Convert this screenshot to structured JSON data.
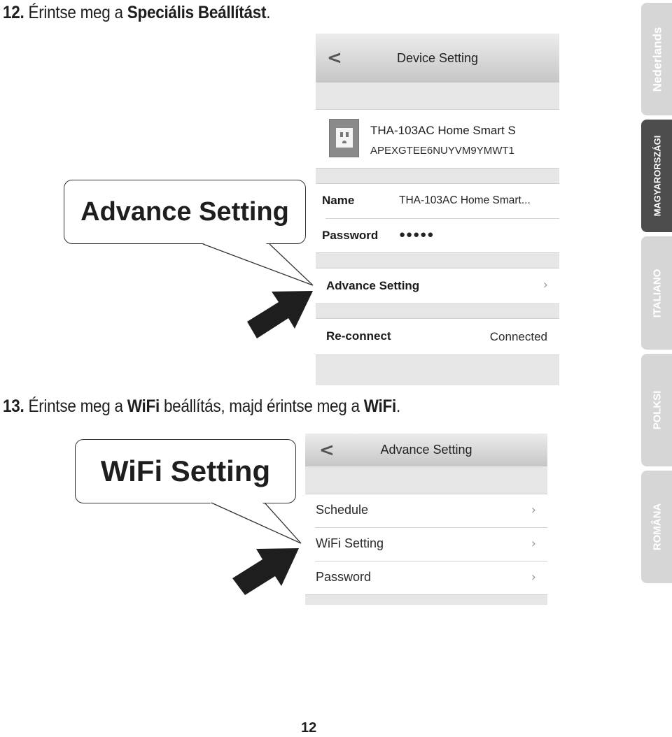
{
  "steps": [
    {
      "number": "12.",
      "text_parts": [
        "Érintse meg a ",
        "Speciális Beállítást",
        "."
      ]
    },
    {
      "number": "13.",
      "text_parts": [
        "Érintse meg a ",
        "WiFi",
        " beállítás, majd érintse meg a ",
        "WiFi",
        "."
      ]
    }
  ],
  "callouts": {
    "step12": "Advance Setting",
    "step13": "WiFi Setting"
  },
  "screen1": {
    "back_icon": "<",
    "title": "Device Setting",
    "device": {
      "icon": "power-outlet-icon",
      "name": "THA-103AC Home Smart S",
      "id": "APEXGTEE6NUYVM9YMWT1"
    },
    "fields": [
      {
        "label": "Name",
        "value": "THA-103AC Home Smart..."
      },
      {
        "label": "Password",
        "value": "●●●●●"
      }
    ],
    "advance_setting": {
      "label": "Advance Setting",
      "chevron": "›"
    },
    "reconnect": {
      "label": "Re-connect",
      "status": "Connected"
    }
  },
  "screen2": {
    "back_icon": "<",
    "title": "Advance Setting",
    "items": [
      {
        "label": "Schedule",
        "chevron": "›"
      },
      {
        "label": "WiFi Setting",
        "chevron": "›"
      },
      {
        "label": "Password",
        "chevron": "›"
      }
    ]
  },
  "language_tabs": [
    {
      "label": "Nederlands",
      "active": false
    },
    {
      "label": "MAGYARORSZÁGI",
      "active": true
    },
    {
      "label": "ITALIANO",
      "active": false
    },
    {
      "label": "POLKSI",
      "active": false
    },
    {
      "label": "ROMÂNA",
      "active": false
    }
  ],
  "page_number": "12"
}
